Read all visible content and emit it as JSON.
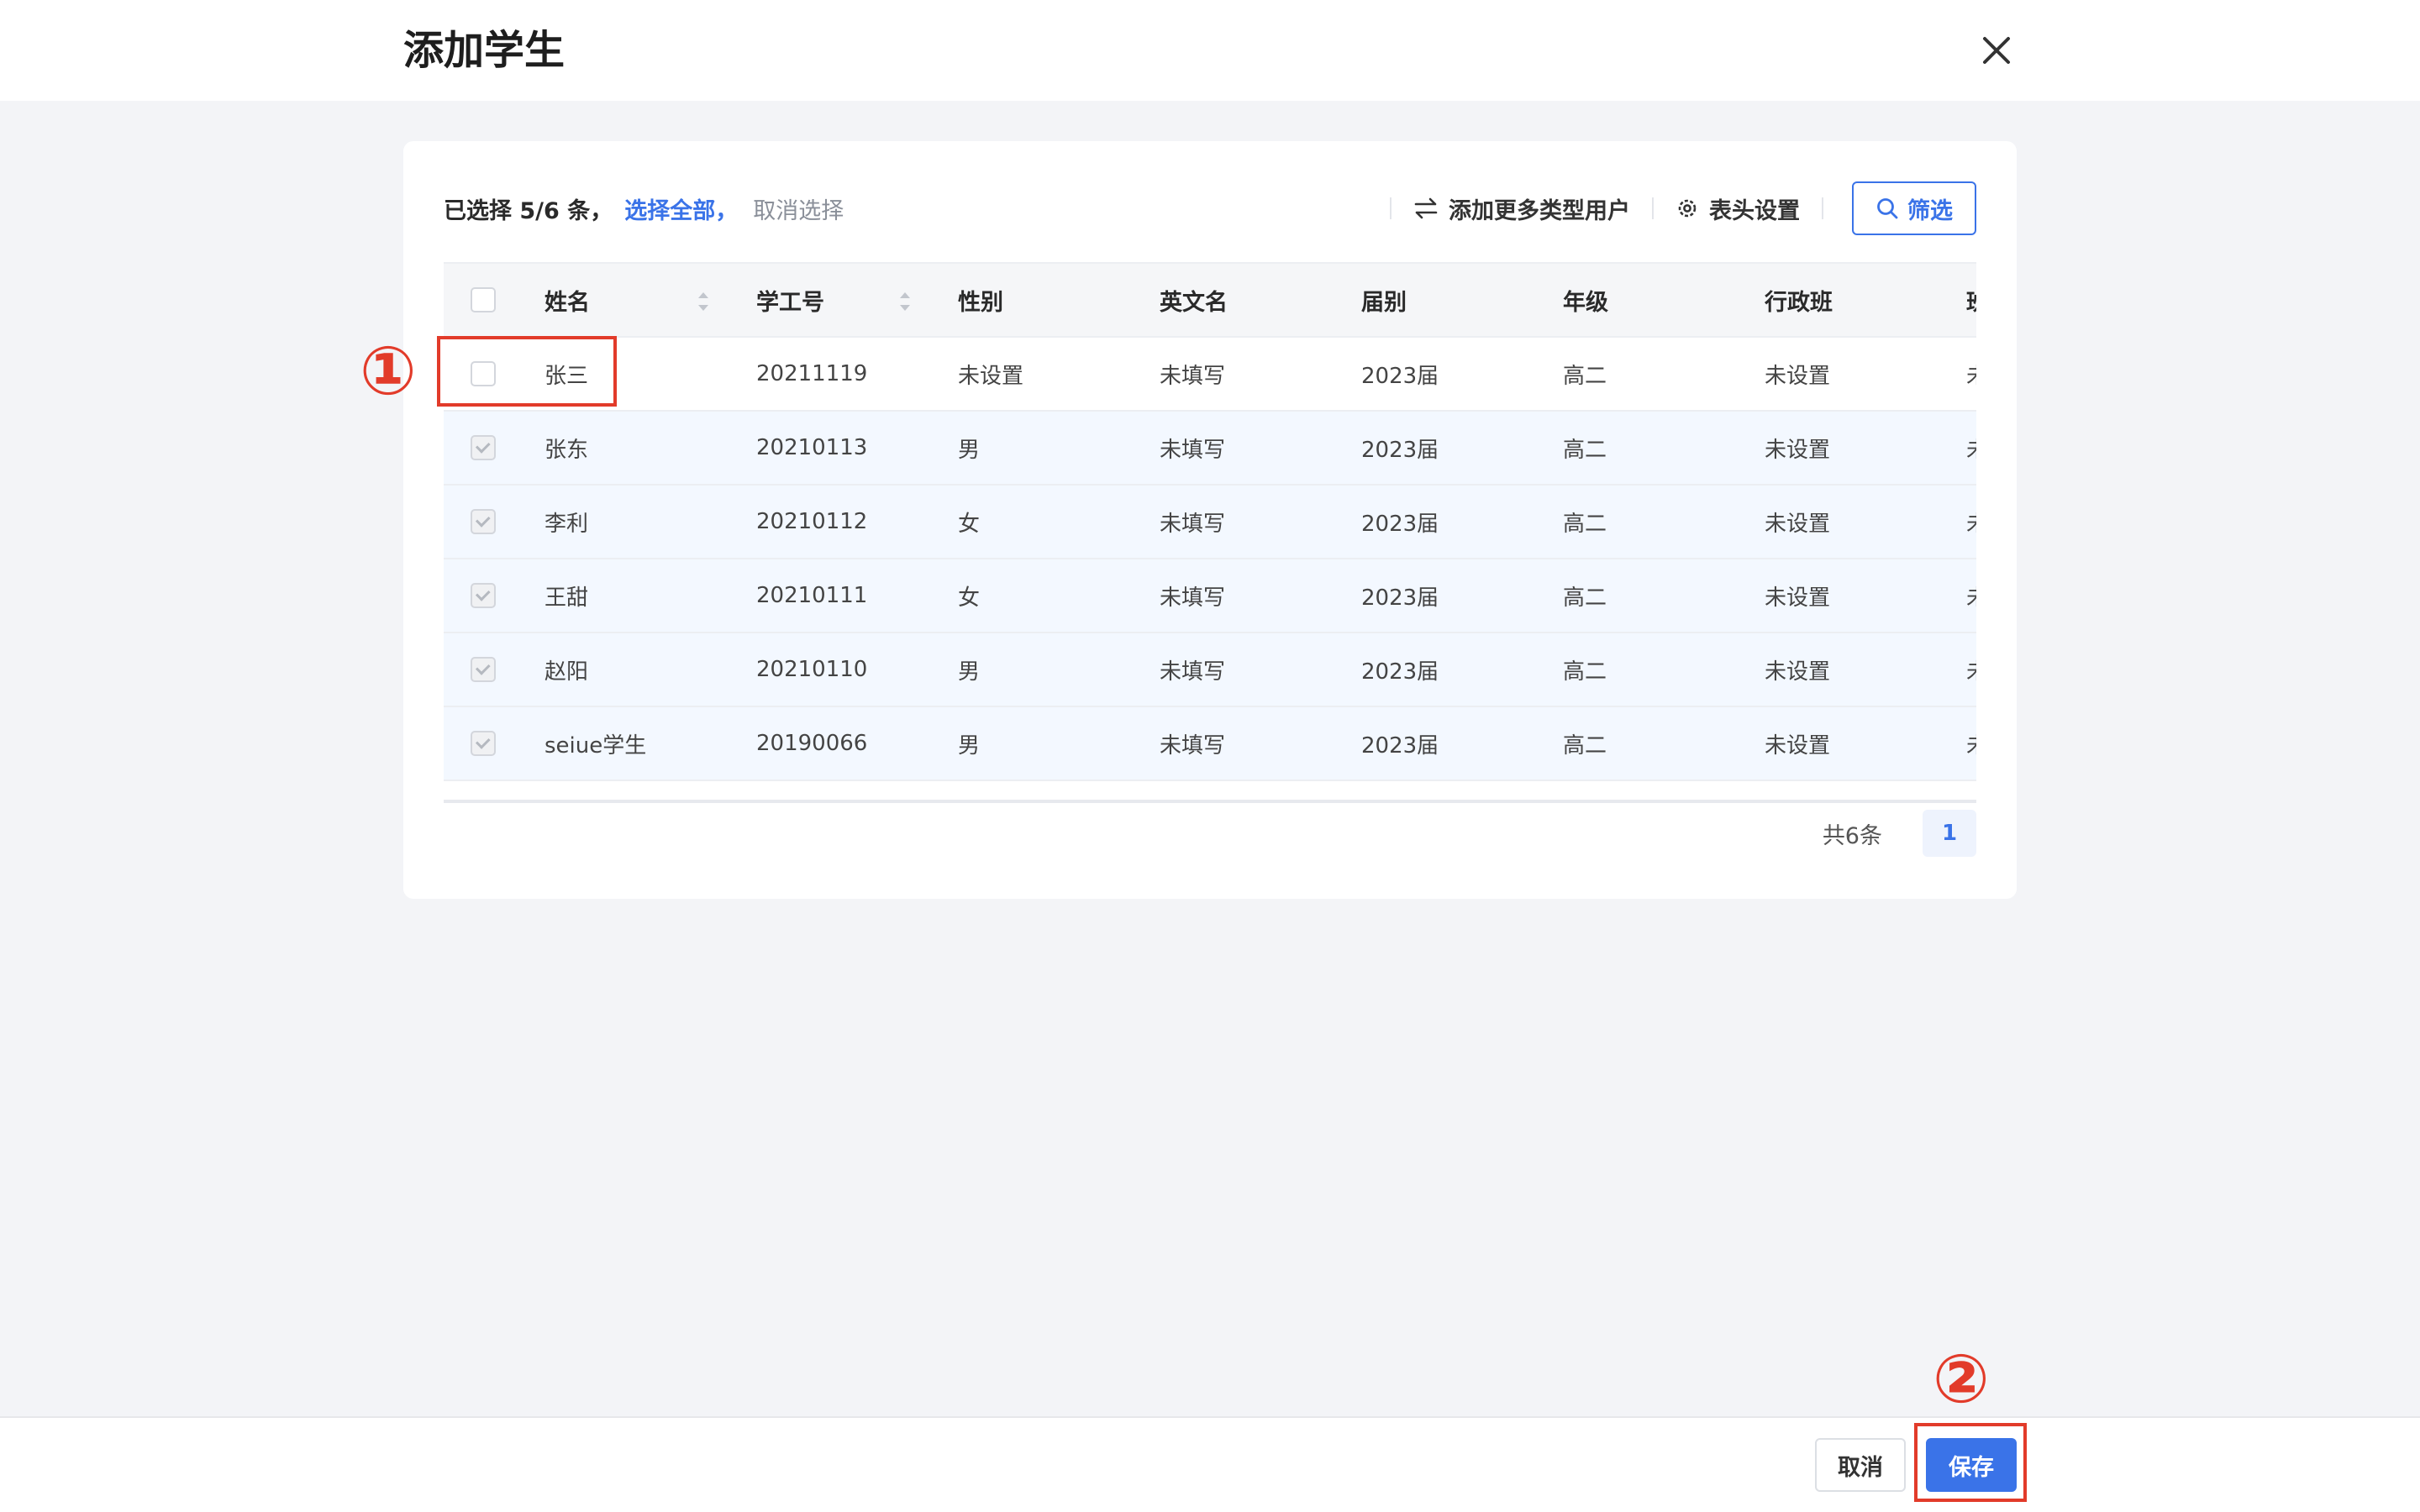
{
  "dialog": {
    "title": "添加学生"
  },
  "toolbar": {
    "selection_text": "已选择 5/6 条，",
    "select_all": "选择全部，",
    "cancel_selection": "取消选择",
    "add_more_types": "添加更多类型用户",
    "header_settings": "表头设置",
    "filter": "筛选"
  },
  "table": {
    "columns": [
      "姓名",
      "学工号",
      "性别",
      "英文名",
      "届别",
      "年级",
      "行政班",
      "班"
    ],
    "rows": [
      {
        "checked": false,
        "name": "张三",
        "id": "20211119",
        "gender": "未设置",
        "english_name": "未填写",
        "class_year": "2023届",
        "grade": "高二",
        "admin_class": "未设置",
        "extra": "未"
      },
      {
        "checked": true,
        "name": "张东",
        "id": "20210113",
        "gender": "男",
        "english_name": "未填写",
        "class_year": "2023届",
        "grade": "高二",
        "admin_class": "未设置",
        "extra": "未"
      },
      {
        "checked": true,
        "name": "李利",
        "id": "20210112",
        "gender": "女",
        "english_name": "未填写",
        "class_year": "2023届",
        "grade": "高二",
        "admin_class": "未设置",
        "extra": "未"
      },
      {
        "checked": true,
        "name": "王甜",
        "id": "20210111",
        "gender": "女",
        "english_name": "未填写",
        "class_year": "2023届",
        "grade": "高二",
        "admin_class": "未设置",
        "extra": "未"
      },
      {
        "checked": true,
        "name": "赵阳",
        "id": "20210110",
        "gender": "男",
        "english_name": "未填写",
        "class_year": "2023届",
        "grade": "高二",
        "admin_class": "未设置",
        "extra": "未"
      },
      {
        "checked": true,
        "name": "seiue学生",
        "id": "20190066",
        "gender": "男",
        "english_name": "未填写",
        "class_year": "2023届",
        "grade": "高二",
        "admin_class": "未设置",
        "extra": "未"
      }
    ]
  },
  "pagination": {
    "total": "共6条",
    "current_page": "1"
  },
  "footer": {
    "cancel": "取消",
    "save": "保存"
  },
  "annotations": [
    {
      "label": "①"
    },
    {
      "label": "②"
    }
  ],
  "colors": {
    "accent": "#3a73e8",
    "annotation": "#e23b2a",
    "selected_row": "#f3f8ff"
  }
}
